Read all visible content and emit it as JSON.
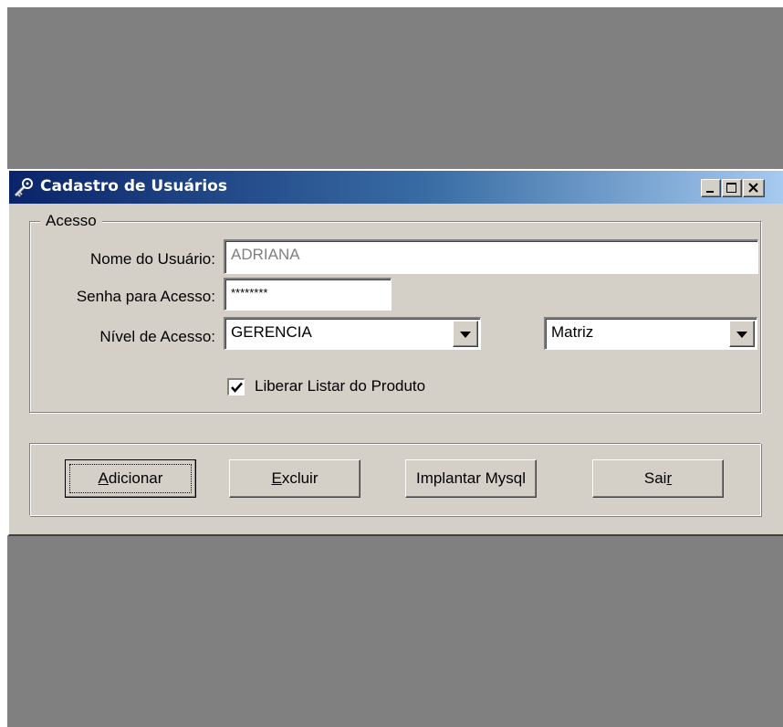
{
  "window": {
    "title": "Cadastro de Usuários",
    "icon": "key-icon",
    "controls": [
      "minimize-icon",
      "maximize-icon",
      "close-icon"
    ]
  },
  "access_group": {
    "legend": "Acesso",
    "user_name_label": "Nome do Usuário:",
    "user_name_value": "ADRIANA",
    "password_label": "Senha para Acesso:",
    "password_value": "********",
    "level_label": "Nível de Acesso:",
    "level_value": "GERENCIA",
    "branch_value": "Matriz",
    "release_checkbox_label": "Liberar Listar do Produto",
    "release_checked": true
  },
  "buttons": {
    "add": {
      "access_key": "A",
      "rest": "dicionar"
    },
    "delete": {
      "access_key": "E",
      "rest": "xcluir"
    },
    "deploy": {
      "label": "Implantar Mysql"
    },
    "exit": {
      "lead": "Sai",
      "access_key": "r"
    }
  },
  "colors": {
    "title_gradient_start": "#0a246a",
    "title_gradient_end": "#a6caf0",
    "face": "#d4d0c8",
    "desktop": "#808080"
  }
}
